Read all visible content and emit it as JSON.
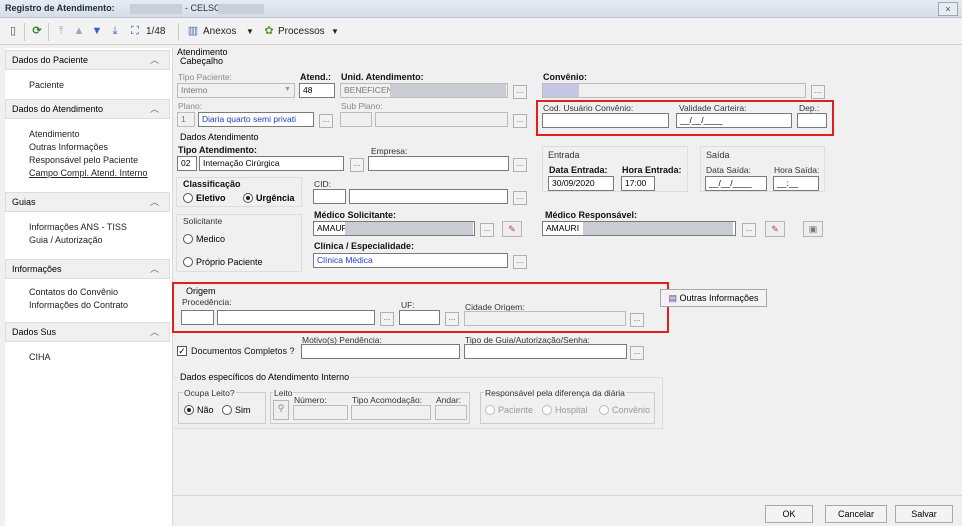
{
  "window": {
    "title": "Registro de Atendimento:",
    "title_suffix": "- CELSO",
    "close_label": "×"
  },
  "toolbar": {
    "record_counter": "1/48",
    "anexos_label": "Anexos",
    "processos_label": "Processos"
  },
  "sidebar": {
    "sections": [
      {
        "label": "Dados do Paciente",
        "items": [
          "Paciente"
        ]
      },
      {
        "label": "Dados do Atendimento",
        "items": [
          "Atendimento",
          "Outras Informações",
          "Responsável pelo Paciente",
          "Campo Compl. Atend. Interno"
        ]
      },
      {
        "label": "Guias",
        "items": [
          "Informações ANS - TISS",
          "Guia / Autorização"
        ]
      },
      {
        "label": "Informações",
        "items": [
          "Contatos do Convênio",
          "Informações do Contrato"
        ]
      },
      {
        "label": "Dados Sus",
        "items": [
          "CIHA"
        ]
      }
    ]
  },
  "atendimento": {
    "title": "Atendimento",
    "cabecalho": "Cabeçalho",
    "tipo_paciente_label": "Tipo Paciente:",
    "tipo_paciente_value": "Interno",
    "atend_label": "Atend.:",
    "atend_value": "48",
    "unid_label": "Unid. Atendimento:",
    "unid_value": "BENEFICENCIA",
    "plano_label": "Plano:",
    "plano_code": "1",
    "plano_value": "Diaria quarto semi privati",
    "subplano_label": "Sub Plano:",
    "convenio_label": "Convênio:",
    "cod_usuario_label": "Cod. Usuário Convênio:",
    "validade_label": "Validade Carteira:",
    "validade_value": "__/__/____",
    "dep_label": "Dep.:"
  },
  "dados_atendimento": {
    "title": "Dados Atendimento",
    "tipo_label": "Tipo Atendimento:",
    "tipo_code": "02",
    "tipo_value": "Internação Cirúrgica",
    "empresa_label": "Empresa:",
    "classificacao_label": "Classificação",
    "eletivo_label": "Eletivo",
    "urgencia_label": "Urgência",
    "solicitante_label": "Solicitante",
    "medico_label": "Medico",
    "proprio_label": "Próprio Paciente",
    "cid_label": "CID:",
    "medico_solicitante_label": "Médico Solicitante:",
    "medico_solicitante_value": "AMAURI .",
    "clinica_label": "Clínica / Especialidade:",
    "clinica_value": "Clínica Médica",
    "entrada_label": "Entrada",
    "data_entrada_label": "Data Entrada:",
    "data_entrada_value": "30/09/2020",
    "hora_entrada_label": "Hora Entrada:",
    "hora_entrada_value": "17:00",
    "saida_label": "Saída",
    "data_saida_label": "Data Saída:",
    "data_saida_value": "__/__/____",
    "hora_saida_label": "Hora Saída:",
    "hora_saida_value": "__:__",
    "medico_responsavel_label": "Médico Responsável:",
    "medico_responsavel_value": "AMAURI"
  },
  "origem": {
    "title": "Origem",
    "procedencia_label": "Procedência:",
    "uf_label": "UF:",
    "cidade_label": "Cidade Origem:",
    "outras_informacoes_label": "Outras Informações"
  },
  "documentos": {
    "checkbox_label": "Documentos Completos ?",
    "checked": true,
    "motivos_label": "Motivo(s) Pendência:",
    "tipo_guia_label": "Tipo de Guia/Autorização/Senha:"
  },
  "internacao": {
    "title": "Dados específicos do Atendimento Interno",
    "ocupa_leito_label": "Ocupa Leito?",
    "nao_label": "Não",
    "sim_label": "Sim",
    "leito_label": "Leito",
    "numero_label": "Número:",
    "tipo_acomodacao_label": "Tipo Acomodação:",
    "andar_label": "Andar:",
    "responsavel_label": "Responsável pela diferença da diária",
    "paciente_label": "Paciente",
    "hospital_label": "Hospital",
    "convenio_label": "Convênio"
  },
  "footer": {
    "ok_label": "OK",
    "cancelar_label": "Cancelar",
    "salvar_label": "Salvar"
  },
  "colors": {
    "highlight_red": "#e21f1f",
    "link_blue": "#1a3ecf"
  }
}
